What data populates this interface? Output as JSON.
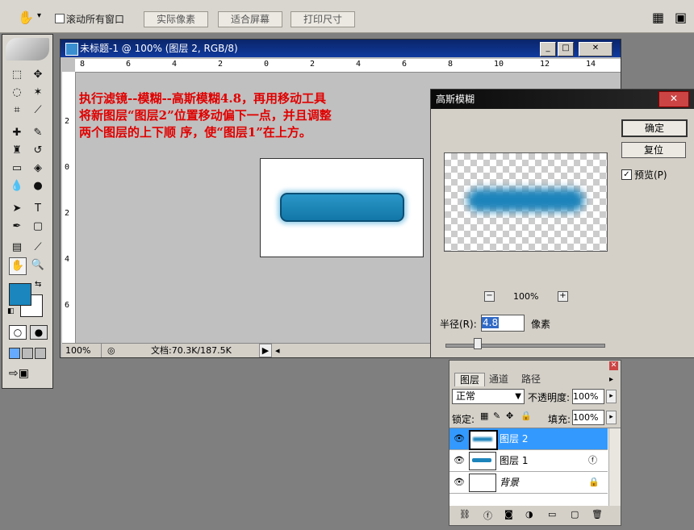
{
  "options_bar": {
    "scroll_all_label": "滚动所有窗口",
    "actual_pixels": "实际像素",
    "fit_screen": "适合屏幕",
    "print_size": "打印尺寸"
  },
  "document": {
    "title": "未标题-1 @ 100% (图层 2, RGB/8)",
    "ruler_h": [
      "8",
      "6",
      "4",
      "2",
      "0",
      "2",
      "4",
      "6",
      "8",
      "10",
      "12",
      "14"
    ],
    "ruler_v": [
      "2",
      "0",
      "2",
      "4",
      "6"
    ],
    "instruction_lines": [
      "执行滤镜--模糊--高斯模糊4.8，再用移动工具",
      "将新图层“图层2”位置移动偏下一点，并且调整",
      "两个图层的上下顺 序，使“图层1”在上方。"
    ],
    "zoom": "100%",
    "doc_size": "文档:70.3K/187.5K"
  },
  "dialog": {
    "title": "高斯模糊",
    "ok": "确定",
    "reset": "复位",
    "preview_label": "预览(P)",
    "preview_checked": true,
    "zoom_value": "100%",
    "radius_label": "半径(R):",
    "radius_value": "4.8",
    "radius_unit": "像素",
    "slider_fraction": 0.2
  },
  "layers": {
    "tabs": [
      "图层",
      "通道",
      "路径"
    ],
    "blend_mode": "正常",
    "opacity_label": "不透明度:",
    "opacity_value": "100%",
    "lock_label": "锁定:",
    "fill_label": "填充:",
    "fill_value": "100%",
    "items": [
      {
        "name": "图层 2",
        "selected": true
      },
      {
        "name": "图层 1",
        "selected": false
      },
      {
        "name": "背景",
        "selected": false
      }
    ]
  },
  "colors": {
    "foreground": "#1a86bd",
    "background": "#ffffff",
    "selection": "#3399ff",
    "instruction_text": "#e00000"
  }
}
